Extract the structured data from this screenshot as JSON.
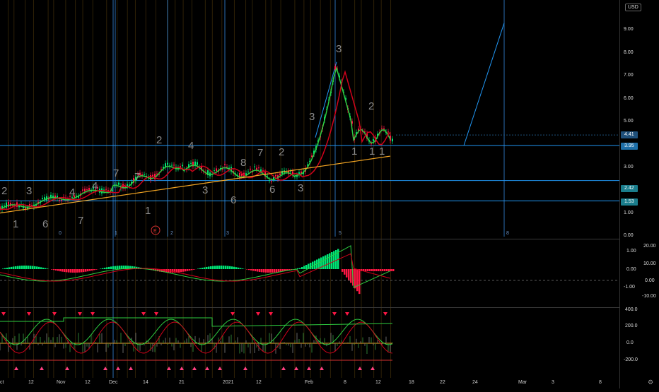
{
  "price_scale": {
    "currency": "USD",
    "ticks": [
      "9.00",
      "8.00",
      "7.00",
      "6.00",
      "5.00",
      "4.00",
      "3.00",
      "2.00",
      "1.00",
      "0.00"
    ],
    "tags": [
      {
        "label": "4.41",
        "color": "#1e4f7a"
      },
      {
        "label": "3.95",
        "color": "#1e6fa8"
      },
      {
        "label": "2.42",
        "color": "#1a7d8c"
      },
      {
        "label": "1.53",
        "color": "#1a7d8c"
      }
    ]
  },
  "macd_scale": {
    "ticks": [
      "1.00",
      "0.00",
      "-1.00"
    ],
    "right_ticks": [
      "20.00",
      "10.00",
      "0.00",
      "-10.00"
    ]
  },
  "osc_scale": {
    "ticks": [
      "400.0",
      "200.0",
      "0.0",
      "-200.0"
    ]
  },
  "time_axis": [
    "ct",
    "12",
    "Nov",
    "12",
    "Dec",
    "14",
    "21",
    "2021",
    "12",
    "Feb",
    "8",
    "12",
    "18",
    "22",
    "24",
    "Mar",
    "3",
    "8",
    "12"
  ],
  "overlay_numbers": [
    {
      "t": "2"
    },
    {
      "t": "3"
    },
    {
      "t": "4"
    },
    {
      "t": "4"
    },
    {
      "t": "7"
    },
    {
      "t": "7"
    },
    {
      "t": "2"
    },
    {
      "t": "4"
    },
    {
      "t": "8"
    },
    {
      "t": "7"
    },
    {
      "t": "2"
    },
    {
      "t": "3"
    },
    {
      "t": "3"
    },
    {
      "t": "2"
    },
    {
      "t": "1"
    },
    {
      "t": "1"
    },
    {
      "t": "1"
    },
    {
      "t": "1"
    },
    {
      "t": "6"
    },
    {
      "t": "7"
    },
    {
      "t": "1"
    },
    {
      "t": "3"
    },
    {
      "t": "6"
    },
    {
      "t": "6"
    },
    {
      "t": "3"
    }
  ],
  "event_marker": "E",
  "small_labels": [
    "0",
    "1",
    "2",
    "3",
    "5",
    "8"
  ],
  "colors": {
    "up": "#00e676",
    "down": "#ff1744",
    "ma_green": "#2ecc40",
    "ma_red": "#d0021b",
    "ma_orange": "#f5a623",
    "hline": "#2196f3"
  }
}
